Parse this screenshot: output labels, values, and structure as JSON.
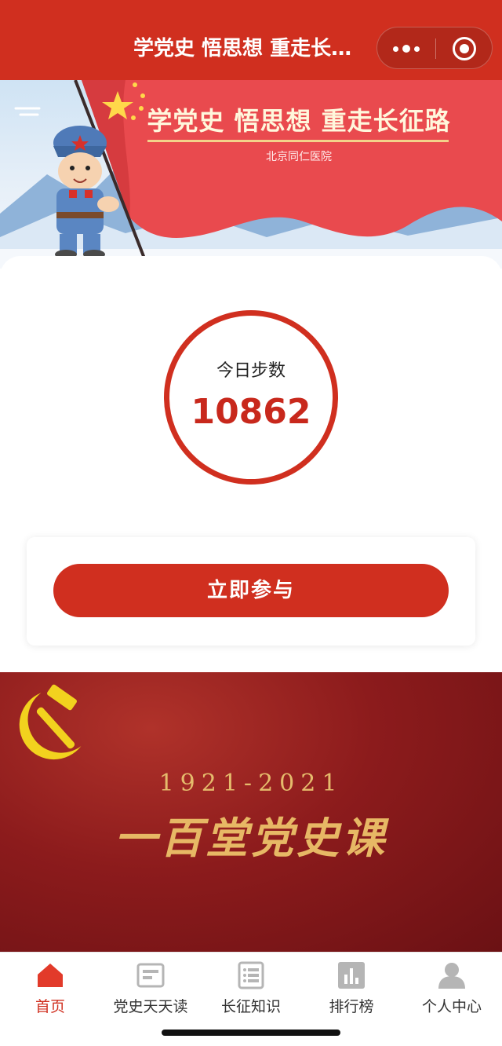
{
  "header": {
    "title": "学党史 悟思想 重走长征路",
    "more_icon": "more-dots-icon",
    "close_icon": "target-close-icon"
  },
  "banner": {
    "title": "学党史  悟思想  重走长征路",
    "subtitle": "北京同仁医院"
  },
  "steps": {
    "label": "今日步数",
    "value": "10862"
  },
  "join": {
    "button_label": "立即参与"
  },
  "lesson": {
    "years": "1921-2021",
    "title": "一百堂党史课"
  },
  "tabbar": {
    "items": [
      {
        "label": "首页",
        "icon": "home-icon",
        "active": true
      },
      {
        "label": "党史天天读",
        "icon": "reading-icon",
        "active": false
      },
      {
        "label": "长征知识",
        "icon": "knowledge-list-icon",
        "active": false
      },
      {
        "label": "排行榜",
        "icon": "ranking-chart-icon",
        "active": false
      },
      {
        "label": "个人中心",
        "icon": "user-profile-icon",
        "active": false
      }
    ]
  },
  "colors": {
    "brand_red": "#d02f1f",
    "step_value": "#c8281c",
    "gold": "#e7b865",
    "inactive_icon": "#b5b5b5"
  }
}
